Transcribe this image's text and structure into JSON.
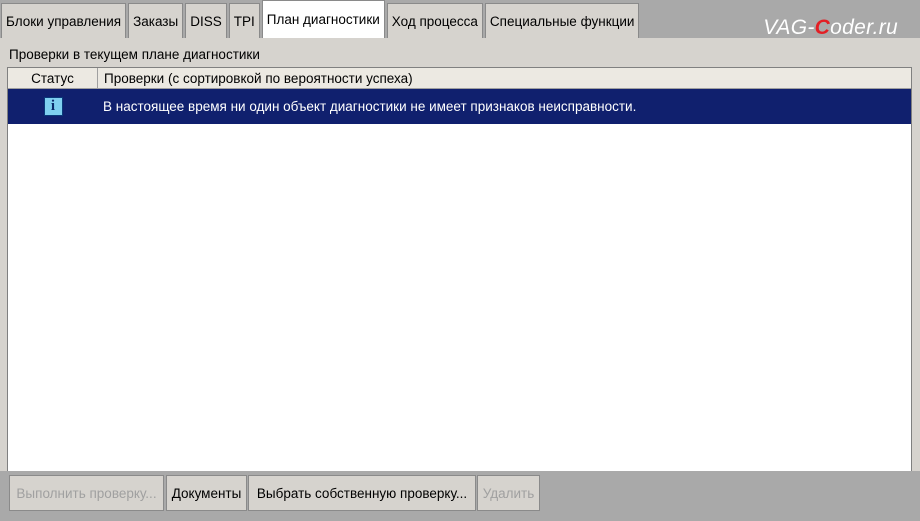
{
  "tabs": [
    {
      "label": "Блоки управления",
      "active": false
    },
    {
      "label": "Заказы",
      "active": false
    },
    {
      "label": "DISS",
      "active": false
    },
    {
      "label": "TPI",
      "active": false
    },
    {
      "label": "План диагностики",
      "active": true
    },
    {
      "label": "Ход процесса",
      "active": false
    },
    {
      "label": "Специальные функции",
      "active": false
    }
  ],
  "watermark": {
    "prefix": "VAG-",
    "highlight": "C",
    "suffix": "oder.ru"
  },
  "section": {
    "title": "Проверки в текущем плане диагностики"
  },
  "table": {
    "columns": {
      "status": "Статус",
      "checks": "Проверки (с сортировкой по вероятности успеха)"
    },
    "rows": [
      {
        "status_icon": "info-icon",
        "icon_glyph": "i",
        "text": "В настоящее время ни один объект диагностики не имеет признаков неисправности."
      }
    ]
  },
  "buttons": {
    "run": {
      "label": "Выполнить проверку...",
      "enabled": false
    },
    "docs": {
      "label": "Документы",
      "enabled": true
    },
    "choose": {
      "label": "Выбрать собственную проверку...",
      "enabled": true
    },
    "delete": {
      "label": "Удалить",
      "enabled": false
    }
  },
  "colors": {
    "selected_row": "#10206e",
    "background": "#a9a9a9",
    "panel": "#d6d3ce",
    "watermark_accent": "#e31e24"
  }
}
